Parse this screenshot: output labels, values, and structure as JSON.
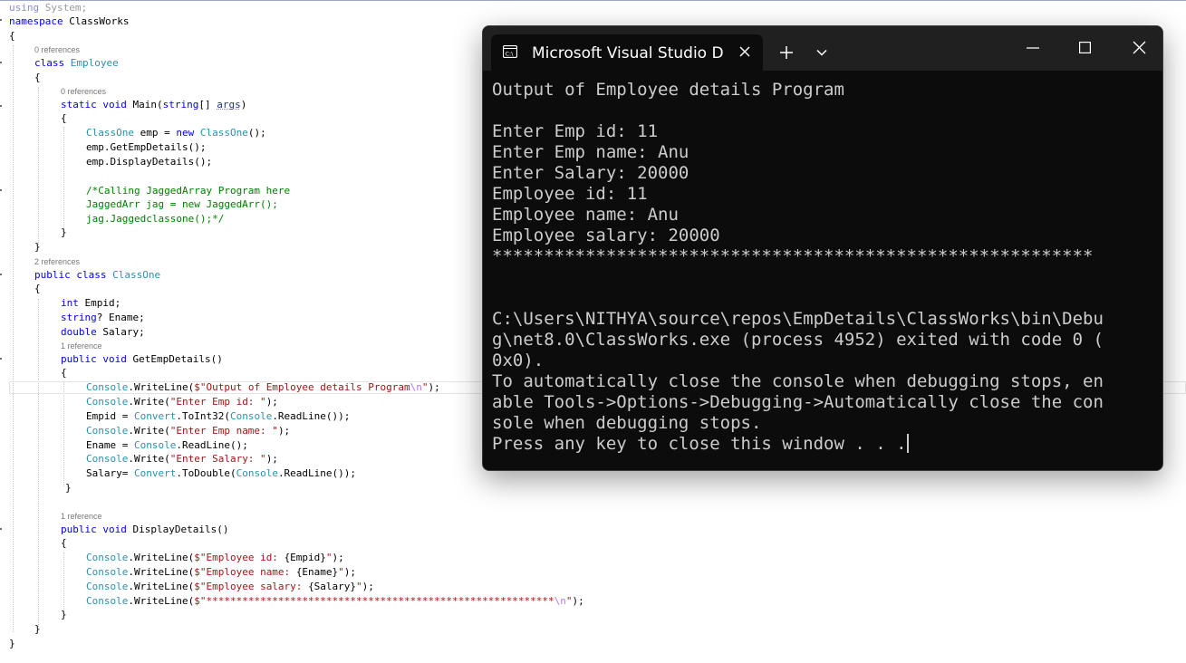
{
  "editor": {
    "lines": {
      "l1": "using System;",
      "l2": "namespace ClassWorks",
      "l3": "{",
      "lens_employee": "0 references",
      "l4": "class Employee",
      "l5": "{",
      "lens_main": "0 references",
      "l6": "static void Main(string[] args)",
      "l7": "{",
      "l8": "ClassOne emp = new ClassOne();",
      "l9": "emp.GetEmpDetails();",
      "l10": "emp.DisplayDetails();",
      "l11": "/*Calling JaggedArray Program here",
      "l12": "JaggedArr jag = new JaggedArr();",
      "l13": "jag.Jaggedclassone();*/",
      "l14": "}",
      "l15": "}",
      "lens_classone": "2 references",
      "l16": "public class ClassOne",
      "l17": "{",
      "l18": "int Empid;",
      "l19": "string? Ename;",
      "l20": "double Salary;",
      "lens_getemp": "1 reference",
      "l21": "public void GetEmpDetails()",
      "l22": "{",
      "l23": "Console.WriteLine($\"Output of Employee details Program\\n\");",
      "l24": "Console.Write(\"Enter Emp id: \");",
      "l25": "Empid = Convert.ToInt32(Console.ReadLine());",
      "l26": "Console.Write(\"Enter Emp name: \");",
      "l27": "Ename = Console.ReadLine();",
      "l28": "Console.Write(\"Enter Salary: \");",
      "l29": "Salary= Convert.ToDouble(Console.ReadLine());",
      "l30": "}",
      "lens_display": "1 reference",
      "l31": "public void DisplayDetails()",
      "l32": "{",
      "l33": "Console.WriteLine($\"Employee id: {Empid}\");",
      "l34": "Console.WriteLine($\"Employee name: {Ename}\");",
      "l35": "Console.WriteLine($\"Employee salary: {Salary}\");",
      "l36": "Console.WriteLine($\"**********************************************************\\n\");",
      "l37": "}",
      "l38": "}",
      "l39": "}"
    }
  },
  "console": {
    "tab_title": "Microsoft Visual Studio Debug Console",
    "tab_icon": "console-app-icon",
    "new_tab_icon": "plus-icon",
    "dropdown_icon": "chevron-down-icon",
    "minimize_icon": "minimize-icon",
    "maximize_icon": "maximize-icon",
    "close_icon": "close-icon",
    "output": "Output of Employee details Program\n\nEnter Emp id: 11\nEnter Emp name: Anu\nEnter Salary: 20000\nEmployee id: 11\nEmployee name: Anu\nEmployee salary: 20000\n**********************************************************\n\n\nC:\\Users\\NITHYA\\source\\repos\\EmpDetails\\ClassWorks\\bin\\Debu\ng\\net8.0\\ClassWorks.exe (process 4952) exited with code 0 (\n0x0).\nTo automatically close the console when debugging stops, en\nable Tools->Options->Debugging->Automatically close the con\nsole when debugging stops.\nPress any key to close this window . . ."
  },
  "colors": {
    "keyword": "#0000ff",
    "type": "#2b91af",
    "string": "#a31515",
    "comment": "#008000",
    "console_bg": "#0c0c0c",
    "console_fg": "#cccccc",
    "titlebar_bg": "#202020"
  }
}
